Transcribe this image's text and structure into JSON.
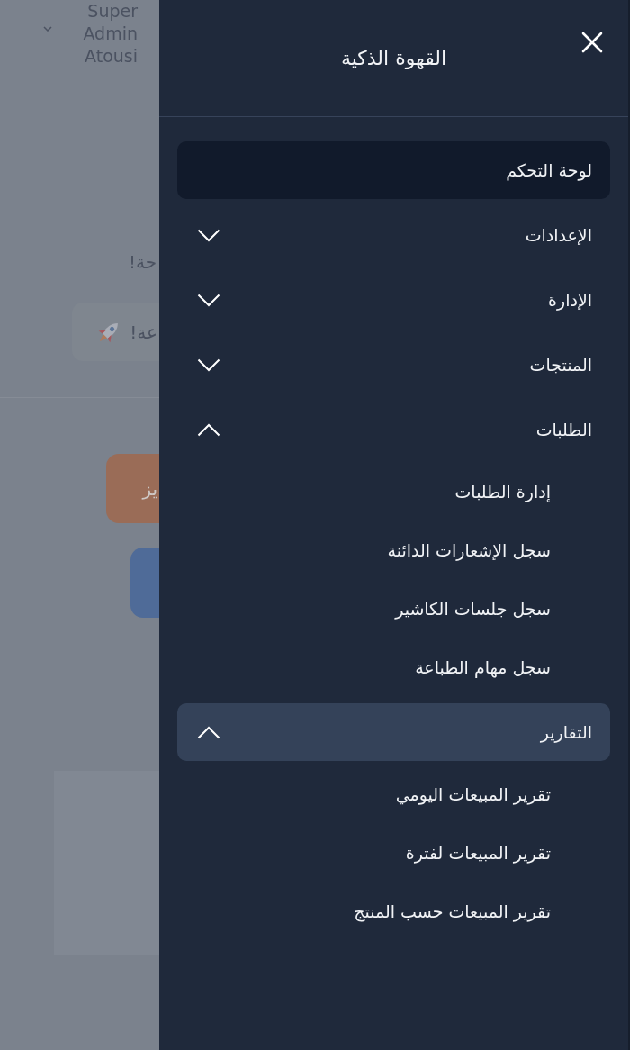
{
  "background_page": {
    "user_name": "Super Admin Atousi",
    "greeting_fragment": "حة!",
    "badge_fragment": "عة!",
    "action_button_fragment": "يز"
  },
  "drawer": {
    "title": "القهوة الذكية",
    "menu": [
      {
        "kind": "link",
        "label": "لوحة التحكم",
        "selected": true,
        "highlighted": false
      },
      {
        "kind": "group",
        "label": "الإعدادات",
        "selected": false,
        "highlighted": false,
        "expanded": false
      },
      {
        "kind": "group",
        "label": "الإدارة",
        "selected": false,
        "highlighted": false,
        "expanded": false
      },
      {
        "kind": "group",
        "label": "المنتجات",
        "selected": false,
        "highlighted": false,
        "expanded": false
      },
      {
        "kind": "group",
        "label": "الطلبات",
        "selected": false,
        "highlighted": false,
        "expanded": true,
        "children": [
          {
            "label": "إدارة الطلبات",
            "selected": false
          },
          {
            "label": "سجل الإشعارات الدائنة",
            "selected": false
          },
          {
            "label": "سجل جلسات الكاشير",
            "selected": false
          },
          {
            "label": "سجل مهام الطباعة",
            "selected": false
          }
        ]
      },
      {
        "kind": "group",
        "label": "التقارير",
        "selected": false,
        "highlighted": true,
        "expanded": true,
        "children": [
          {
            "label": "تقرير المبيعات اليومي",
            "selected": false
          },
          {
            "label": "تقرير المبيعات لفترة",
            "selected": false
          },
          {
            "label": "تقرير المبيعات حسب المنتج",
            "selected": false
          }
        ]
      }
    ]
  }
}
